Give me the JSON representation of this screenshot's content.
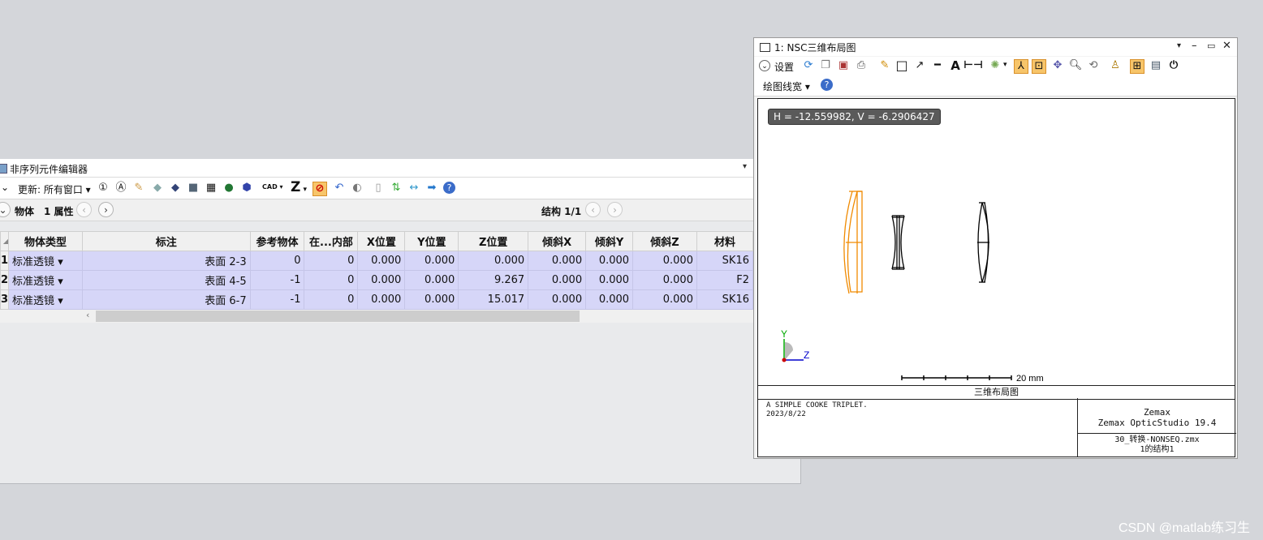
{
  "nce": {
    "title": "非序列元件编辑器",
    "dropdown_glyph": "▾",
    "update_label": "更新: 所有窗口",
    "cad_label": "CAD",
    "z_label": "Z",
    "tabs": {
      "object": "物体",
      "properties": "1 属性"
    },
    "config_label": "结构 1/1",
    "columns": [
      "物体类型",
      "标注",
      "参考物体",
      "在...内部",
      "X位置",
      "Y位置",
      "Z位置",
      "倾斜X",
      "倾斜Y",
      "倾斜Z",
      "材料"
    ],
    "rows": [
      {
        "num": "1",
        "type": "标准透镜",
        "comment": "表面 2-3",
        "ref": "0",
        "inside": "0",
        "x": "0.000",
        "y": "0.000",
        "z": "0.000",
        "tx": "0.000",
        "ty": "0.000",
        "tz": "0.000",
        "material": "SK16"
      },
      {
        "num": "2",
        "type": "标准透镜",
        "comment": "表面 4-5",
        "ref": "-1",
        "inside": "0",
        "x": "0.000",
        "y": "0.000",
        "z": "9.267",
        "tx": "0.000",
        "ty": "0.000",
        "tz": "0.000",
        "material": "F2"
      },
      {
        "num": "3",
        "type": "标准透镜",
        "comment": "表面 6-7",
        "ref": "-1",
        "inside": "0",
        "x": "0.000",
        "y": "0.000",
        "z": "15.017",
        "tx": "0.000",
        "ty": "0.000",
        "tz": "0.000",
        "material": "SK16"
      }
    ]
  },
  "nsc": {
    "title": "1: NSC三维布局图",
    "settings_label": "设置",
    "linewidth_label": "绘图线宽",
    "coord_readout": "H = -12.559982, V = -6.2906427",
    "axis_y": "Y",
    "axis_z": "Z",
    "scale_label": "20 mm",
    "plot_title": "三维布局图",
    "info_line1": "A SIMPLE COOKE TRIPLET.",
    "info_line2": "2023/8/22",
    "company": "Zemax",
    "product": "Zemax OpticStudio 19.4",
    "file": "30_转换-NONSEQ.zmx",
    "config": "1的结构1",
    "colors": {
      "lens1": "#f08a00",
      "lens": "#000000"
    }
  },
  "watermark": "CSDN @matlab练习生"
}
